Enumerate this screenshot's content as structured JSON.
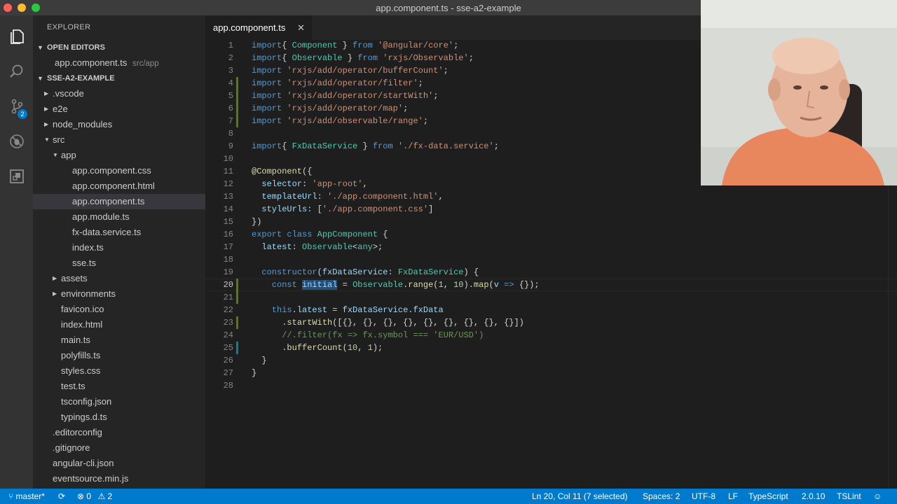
{
  "window": {
    "title": "app.component.ts - sse-a2-example"
  },
  "activity_bar": {
    "items": [
      "files-icon",
      "search-icon",
      "source-control-icon",
      "debug-icon",
      "extensions-icon"
    ],
    "scm_badge": "2"
  },
  "sidebar": {
    "title": "EXPLORER",
    "open_editors_label": "OPEN EDITORS",
    "open_editor_file": "app.component.ts",
    "open_editor_path": "src/app",
    "project_label": "SSE-A2-EXAMPLE",
    "tree": [
      {
        "label": ".vscode",
        "kind": "folder-closed"
      },
      {
        "label": "e2e",
        "kind": "folder-closed"
      },
      {
        "label": "node_modules",
        "kind": "folder-closed"
      },
      {
        "label": "src",
        "kind": "folder-open"
      },
      {
        "label": "app",
        "kind": "folder-open"
      },
      {
        "label": "app.component.css",
        "kind": "file"
      },
      {
        "label": "app.component.html",
        "kind": "file"
      },
      {
        "label": "app.component.ts",
        "kind": "file",
        "selected": true
      },
      {
        "label": "app.module.ts",
        "kind": "file"
      },
      {
        "label": "fx-data.service.ts",
        "kind": "file"
      },
      {
        "label": "index.ts",
        "kind": "file"
      },
      {
        "label": "sse.ts",
        "kind": "file"
      },
      {
        "label": "assets",
        "kind": "folder-closed"
      },
      {
        "label": "environments",
        "kind": "folder-closed"
      },
      {
        "label": "favicon.ico",
        "kind": "file"
      },
      {
        "label": "index.html",
        "kind": "file"
      },
      {
        "label": "main.ts",
        "kind": "file"
      },
      {
        "label": "polyfills.ts",
        "kind": "file"
      },
      {
        "label": "styles.css",
        "kind": "file"
      },
      {
        "label": "test.ts",
        "kind": "file"
      },
      {
        "label": "tsconfig.json",
        "kind": "file"
      },
      {
        "label": "typings.d.ts",
        "kind": "file"
      },
      {
        "label": ".editorconfig",
        "kind": "file"
      },
      {
        "label": ".gitignore",
        "kind": "file"
      },
      {
        "label": "angular-cli.json",
        "kind": "file"
      },
      {
        "label": "eventsource.min.js",
        "kind": "file"
      }
    ]
  },
  "editor": {
    "tab_label": "app.component.ts",
    "tab_close": "✕",
    "current_line": 20,
    "lines": [
      [
        [
          "kw",
          "import"
        ],
        [
          "",
          "{ "
        ],
        [
          "ty",
          "Component"
        ],
        [
          "",
          " } "
        ],
        [
          "kw",
          "from"
        ],
        [
          "",
          " "
        ],
        [
          "str",
          "'@angular/core'"
        ],
        [
          "",
          ";"
        ]
      ],
      [
        [
          "kw",
          "import"
        ],
        [
          "",
          "{ "
        ],
        [
          "ty",
          "Observable"
        ],
        [
          "",
          " } "
        ],
        [
          "kw",
          "from"
        ],
        [
          "",
          " "
        ],
        [
          "str",
          "'rxjs/Observable'"
        ],
        [
          "",
          ";"
        ]
      ],
      [
        [
          "kw",
          "import"
        ],
        [
          "",
          " "
        ],
        [
          "str",
          "'rxjs/add/operator/bufferCount'"
        ],
        [
          "",
          ";"
        ]
      ],
      [
        [
          "kw",
          "import"
        ],
        [
          "",
          " "
        ],
        [
          "str",
          "'rxjs/add/operator/filter'"
        ],
        [
          "",
          ";"
        ]
      ],
      [
        [
          "kw",
          "import"
        ],
        [
          "",
          " "
        ],
        [
          "str",
          "'rxjs/add/operator/startWith'"
        ],
        [
          "",
          ";"
        ]
      ],
      [
        [
          "kw",
          "import"
        ],
        [
          "",
          " "
        ],
        [
          "str",
          "'rxjs/add/operator/map'"
        ],
        [
          "",
          ";"
        ]
      ],
      [
        [
          "kw",
          "import"
        ],
        [
          "",
          " "
        ],
        [
          "str",
          "'rxjs/add/observable/range'"
        ],
        [
          "",
          ";"
        ]
      ],
      [],
      [
        [
          "kw",
          "import"
        ],
        [
          "",
          "{ "
        ],
        [
          "ty",
          "FxDataService"
        ],
        [
          "",
          " } "
        ],
        [
          "kw",
          "from"
        ],
        [
          "",
          " "
        ],
        [
          "str",
          "'./fx-data.service'"
        ],
        [
          "",
          ";"
        ]
      ],
      [],
      [
        [
          "dec",
          "@Component"
        ],
        [
          "",
          "({"
        ]
      ],
      [
        [
          "",
          "  "
        ],
        [
          "var",
          "selector"
        ],
        [
          "",
          ": "
        ],
        [
          "str",
          "'app-root'"
        ],
        [
          "",
          ","
        ]
      ],
      [
        [
          "",
          "  "
        ],
        [
          "var",
          "templateUrl"
        ],
        [
          "",
          ": "
        ],
        [
          "str",
          "'./app.component.html'"
        ],
        [
          "",
          ","
        ]
      ],
      [
        [
          "",
          "  "
        ],
        [
          "var",
          "styleUrls"
        ],
        [
          "",
          ": ["
        ],
        [
          "str",
          "'./app.component.css'"
        ],
        [
          "",
          "]"
        ]
      ],
      [
        [
          "",
          "})"
        ]
      ],
      [
        [
          "kw",
          "export"
        ],
        [
          "",
          " "
        ],
        [
          "kw",
          "class"
        ],
        [
          "",
          " "
        ],
        [
          "ty",
          "AppComponent"
        ],
        [
          "",
          " {"
        ]
      ],
      [
        [
          "",
          "  "
        ],
        [
          "var",
          "latest"
        ],
        [
          "",
          ": "
        ],
        [
          "ty",
          "Observable"
        ],
        [
          "",
          "<"
        ],
        [
          "ty",
          "any"
        ],
        [
          "",
          ">;"
        ]
      ],
      [],
      [
        [
          "",
          "  "
        ],
        [
          "kw",
          "constructor"
        ],
        [
          "",
          "("
        ],
        [
          "var",
          "fxDataService"
        ],
        [
          "",
          ": "
        ],
        [
          "ty",
          "FxDataService"
        ],
        [
          "",
          ") {"
        ]
      ],
      [
        [
          "",
          "    "
        ],
        [
          "kw",
          "const"
        ],
        [
          "",
          " "
        ],
        [
          "sel",
          "initial"
        ],
        [
          "",
          " = "
        ],
        [
          "ty",
          "Observable"
        ],
        [
          "",
          "."
        ],
        [
          "fn",
          "range"
        ],
        [
          "",
          "("
        ],
        [
          "num",
          "1"
        ],
        [
          "",
          ", "
        ],
        [
          "num",
          "10"
        ],
        [
          "",
          ")."
        ],
        [
          "fn",
          "map"
        ],
        [
          "",
          "("
        ],
        [
          "var",
          "v"
        ],
        [
          "",
          " "
        ],
        [
          "kw",
          "=>"
        ],
        [
          "",
          " {});"
        ]
      ],
      [],
      [
        [
          "",
          "    "
        ],
        [
          "kw",
          "this"
        ],
        [
          "",
          "."
        ],
        [
          "var",
          "latest"
        ],
        [
          "",
          " = "
        ],
        [
          "var",
          "fxDataService"
        ],
        [
          "",
          "."
        ],
        [
          "var",
          "fxData"
        ]
      ],
      [
        [
          "",
          "      ."
        ],
        [
          "fn",
          "startWith"
        ],
        [
          "",
          "([{}, {}, {}, {}, {}, {}, {}, {}, {}])"
        ]
      ],
      [
        [
          "",
          "      "
        ],
        [
          "cm",
          "//.filter(fx => fx.symbol === 'EUR/USD')"
        ]
      ],
      [
        [
          "",
          "      ."
        ],
        [
          "fn",
          "bufferCount"
        ],
        [
          "",
          "("
        ],
        [
          "num",
          "10"
        ],
        [
          "",
          ", "
        ],
        [
          "num",
          "1"
        ],
        [
          "",
          ");"
        ]
      ],
      [
        [
          "",
          "  }"
        ]
      ],
      [
        [
          "",
          "}"
        ]
      ],
      []
    ]
  },
  "status_bar": {
    "branch": "master*",
    "errors": "0",
    "warnings": "2",
    "cursor": "Ln 20, Col 11 (7 selected)",
    "spaces": "Spaces: 2",
    "encoding": "UTF-8",
    "eol": "LF",
    "language": "TypeScript",
    "ts_version": "2.0.10",
    "linter": "TSLint"
  },
  "colors": {
    "status_bar": "#007acc",
    "git_added": "#587c0c",
    "git_modified": "#0c7d9d"
  }
}
